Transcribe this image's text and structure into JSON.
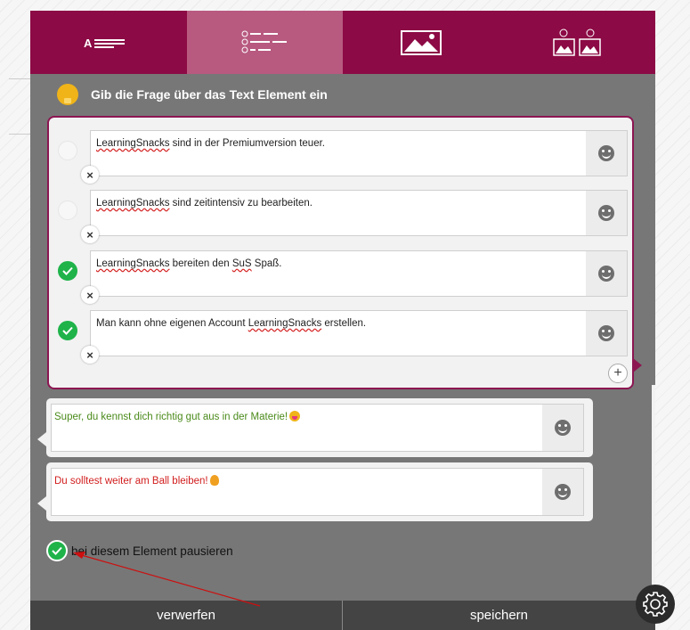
{
  "toolbar": {
    "buttons": [
      {
        "name": "text-mode",
        "glyph": "A"
      },
      {
        "name": "list-mode"
      },
      {
        "name": "image-mode"
      },
      {
        "name": "image-choice-mode"
      }
    ]
  },
  "hint": "Gib die Frage über das Text Element ein",
  "answers": [
    {
      "spell": "LearningSnacks",
      "rest": " sind in der Premiumversion teuer.",
      "correct": false
    },
    {
      "spell": "LearningSnacks",
      "rest": " sind zeitintensiv zu bearbeiten.",
      "correct": false
    },
    {
      "spell": "LearningSnacks",
      "rest": " bereiten den ",
      "spell2": "SuS",
      "rest2": " Spaß.",
      "correct": true
    },
    {
      "pre": "Man kann ohne eigenen Account ",
      "spell": "LearningSnacks",
      "rest": " erstellen.",
      "correct": true
    }
  ],
  "delete_glyph": "×",
  "add_glyph": "+",
  "feedback": {
    "positive": "Super, du kennst dich richtig gut aus in der Materie!",
    "negative": "Du solltest weiter am Ball bleiben!"
  },
  "pause_label": "bei diesem Element pausieren",
  "bottom": {
    "discard": "verwerfen",
    "save": "speichern"
  },
  "colors": {
    "brand": "#8c0a45",
    "active_tab": "#b85a80",
    "correct": "#1fb34a",
    "arrow": "#cc1010"
  }
}
